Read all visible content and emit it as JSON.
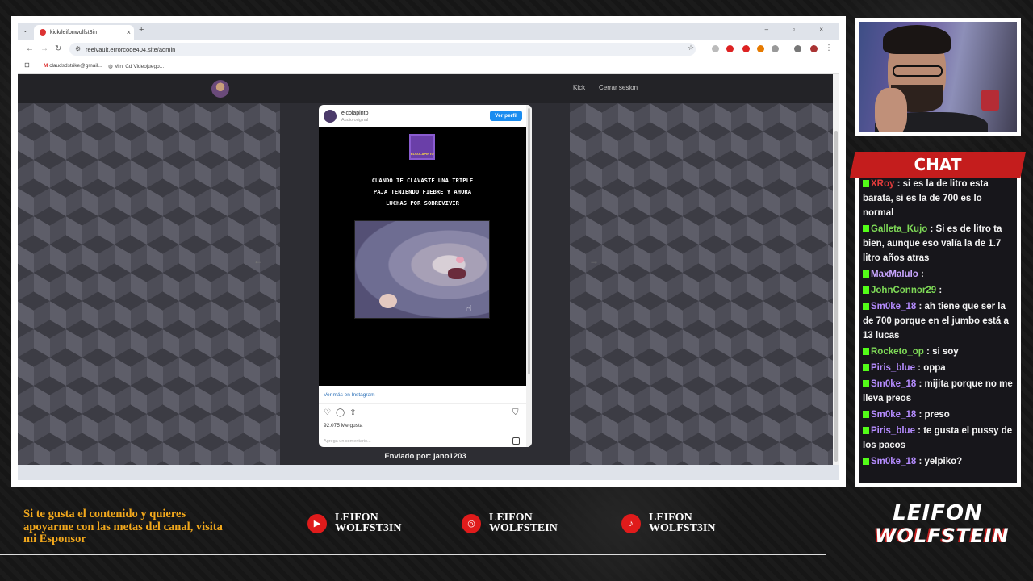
{
  "browser": {
    "tab_title": "kick/leifonwolfst3in",
    "tab_close": "×",
    "new_tab": "+",
    "window_controls": "– ▫ ×",
    "url": "reelvault.errorcode404.site/admin",
    "bookmarks": [
      "claudsdstrike@gmail...",
      "Mini Cd Videojuego..."
    ]
  },
  "site": {
    "nav": [
      "Kick",
      "Cerrar sesion"
    ],
    "prev_arrow": "←",
    "next_arrow": "→",
    "sent_by": "Enviado por: jano1203"
  },
  "post": {
    "username": "elcolapinto",
    "audio": "Audio original",
    "view_profile": "Ver perfil",
    "logo_text": "ELCOLAPINTO",
    "caption": [
      "CUANDO TE CLAVASTE UNA TRIPLE",
      "PAJA TENIENDO FIEBRE Y AHORA",
      "LUCHAS POR SOBREVIVIR"
    ],
    "more": "Ver más en Instagram",
    "likes": "92.075 Me gusta",
    "comment_placeholder": "Agrega un comentario..."
  },
  "chat": {
    "title": "CHAT",
    "messages": [
      {
        "user": "Sm0ke_18",
        "color": "#b58cff",
        "text": ""
      },
      {
        "user": "XRoy",
        "color": "#e23b3b",
        "text": "si es la de litro esta barata, si es la de 700 es lo normal"
      },
      {
        "user": "Galleta_Kujo",
        "color": "#7ed957",
        "text": "Si es de litro ta bien, aunque eso valía la de 1.7 litro años atras"
      },
      {
        "user": "MaxMalulo",
        "color": "#c9a6ff",
        "text": ""
      },
      {
        "user": "JohnConnor29",
        "color": "#7ed957",
        "text": ""
      },
      {
        "user": "Sm0ke_18",
        "color": "#b58cff",
        "text": "ah tiene que ser la de 700 porque en el jumbo está a 13 lucas"
      },
      {
        "user": "Rocketo_op",
        "color": "#7ed957",
        "text": "si soy"
      },
      {
        "user": "Piris_blue",
        "color": "#b58cff",
        "text": "oppa"
      },
      {
        "user": "Sm0ke_18",
        "color": "#b58cff",
        "text": "mijita porque no me lleva preos"
      },
      {
        "user": "Sm0ke_18",
        "color": "#b58cff",
        "text": "preso"
      },
      {
        "user": "Piris_blue",
        "color": "#b58cff",
        "text": "te gusta el pussy de los pacos"
      },
      {
        "user": "Sm0ke_18",
        "color": "#b58cff",
        "text": "yelpiko?"
      }
    ]
  },
  "footer": {
    "promo": "Si te gusta el contenido y quieres apoyarme con las metas del canal, visita mi Esponsor",
    "socials": [
      {
        "icon": "youtube-icon",
        "line1": "LEIFON",
        "line2": "WOLFST3IN"
      },
      {
        "icon": "instagram-icon",
        "line1": "LEIFON",
        "line2": "WOLFSTEIN"
      },
      {
        "icon": "tiktok-icon",
        "line1": "LEIFON",
        "line2": "WOLFST3IN"
      }
    ],
    "brand_top": "LEIFON",
    "brand_bottom": "WOLFSTEIN"
  }
}
